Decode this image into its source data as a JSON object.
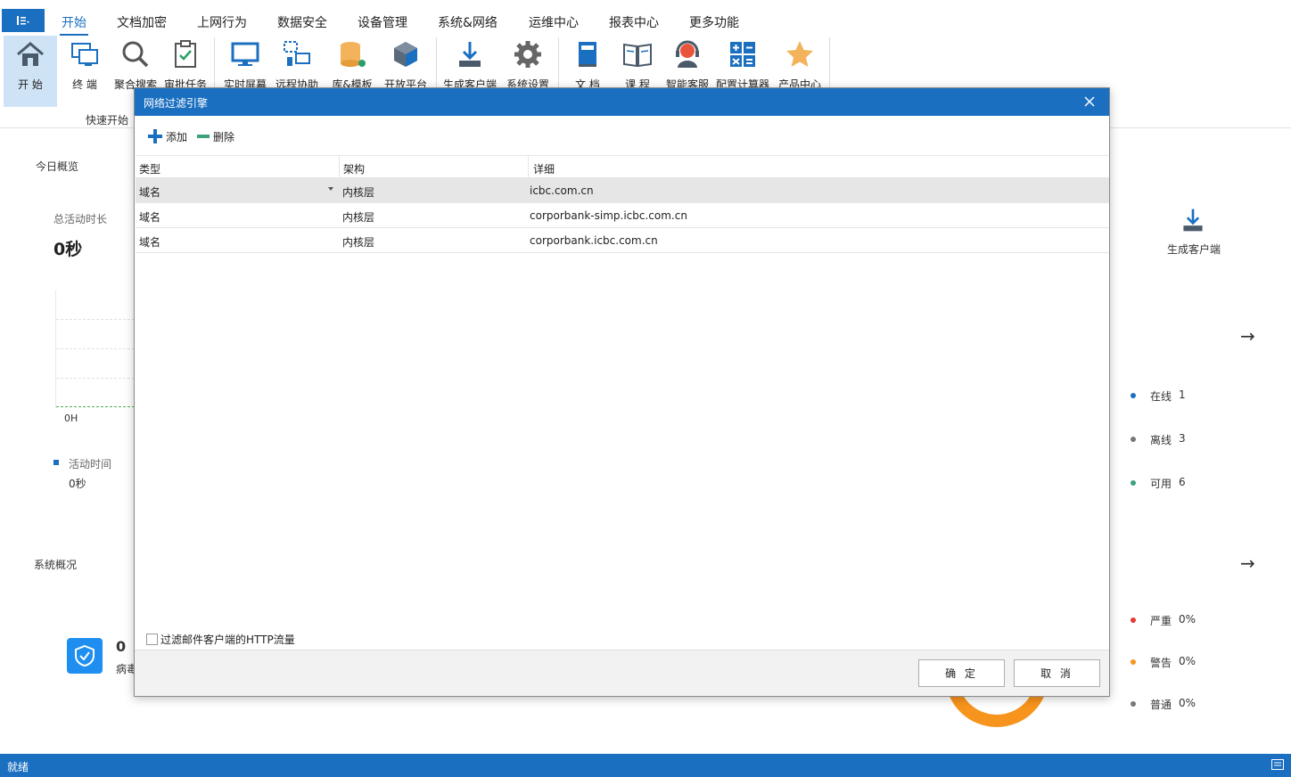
{
  "menubar": {
    "app_menu_icon": "app-menu-icon",
    "tabs": [
      {
        "label": "开始",
        "active": true
      },
      {
        "label": "文档加密"
      },
      {
        "label": "上网行为"
      },
      {
        "label": "数据安全"
      },
      {
        "label": "设备管理"
      },
      {
        "label": "系统&网络"
      },
      {
        "label": "运维中心"
      },
      {
        "label": "报表中心"
      },
      {
        "label": "更多功能"
      }
    ]
  },
  "ribbon": {
    "group_label": "快速开始",
    "buttons": [
      {
        "label": "开 始",
        "icon": "home-icon"
      },
      {
        "label": "终 端",
        "icon": "terminal-icon"
      },
      {
        "label": "聚合搜索",
        "icon": "search-icon"
      },
      {
        "label": "审批任务",
        "icon": "clipboard-check-icon"
      },
      {
        "label": "实时屏幕",
        "icon": "monitor-icon"
      },
      {
        "label": "远程协助",
        "icon": "remote-assist-icon"
      },
      {
        "label": "库&模板",
        "icon": "database-icon"
      },
      {
        "label": "开放平台",
        "icon": "cube-icon"
      },
      {
        "label": "生成客户端",
        "icon": "download-icon"
      },
      {
        "label": "系统设置",
        "icon": "gear-icon"
      },
      {
        "label": "文 档",
        "icon": "book-icon"
      },
      {
        "label": "课 程",
        "icon": "open-book-icon"
      },
      {
        "label": "智能客服",
        "icon": "headset-icon"
      },
      {
        "label": "配置计算器",
        "icon": "calculator-icon"
      },
      {
        "label": "产品中心",
        "icon": "star-icon"
      }
    ]
  },
  "dashboard": {
    "today_overview": "今日概览",
    "total_active_label": "总活动时长",
    "total_active_value": "0秒",
    "axis_label": "0H",
    "legend_label": "活动时间",
    "legend_value": "0秒",
    "system_overview": "系统概况",
    "virus_count": "0",
    "virus_label": "病毒",
    "generate_client": "生成客户端",
    "online_label": "在线",
    "online_value": "1",
    "offline_label": "离线",
    "offline_value": "3",
    "available_label": "可用",
    "available_value": "6",
    "severe_label": "严重",
    "severe_value": "0%",
    "warning_label": "警告",
    "warning_value": "0%",
    "normal_label": "普通",
    "normal_value": "0%",
    "colors": {
      "online": "#1b6fc0",
      "offline": "#777777",
      "available": "#3aa37a",
      "severe": "#e53935",
      "warning": "#f7941d",
      "normal": "#777777"
    }
  },
  "dialog": {
    "title": "网络过滤引擎",
    "toolbar": {
      "add": "添加",
      "delete": "删除"
    },
    "columns": [
      "类型",
      "架构",
      "详细"
    ],
    "rows": [
      {
        "type": "域名",
        "arch": "内核层",
        "detail": "icbc.com.cn",
        "selected": true
      },
      {
        "type": "域名",
        "arch": "内核层",
        "detail": "corporbank-simp.icbc.com.cn"
      },
      {
        "type": "域名",
        "arch": "内核层",
        "detail": "corporbank.icbc.com.cn"
      }
    ],
    "checkbox_label": "过滤邮件客户端的HTTP流量",
    "checkbox_checked": false,
    "ok": "确 定",
    "cancel": "取 消"
  },
  "statusbar": {
    "text": "就绪"
  },
  "colors": {
    "accent": "#1b6fc0"
  }
}
